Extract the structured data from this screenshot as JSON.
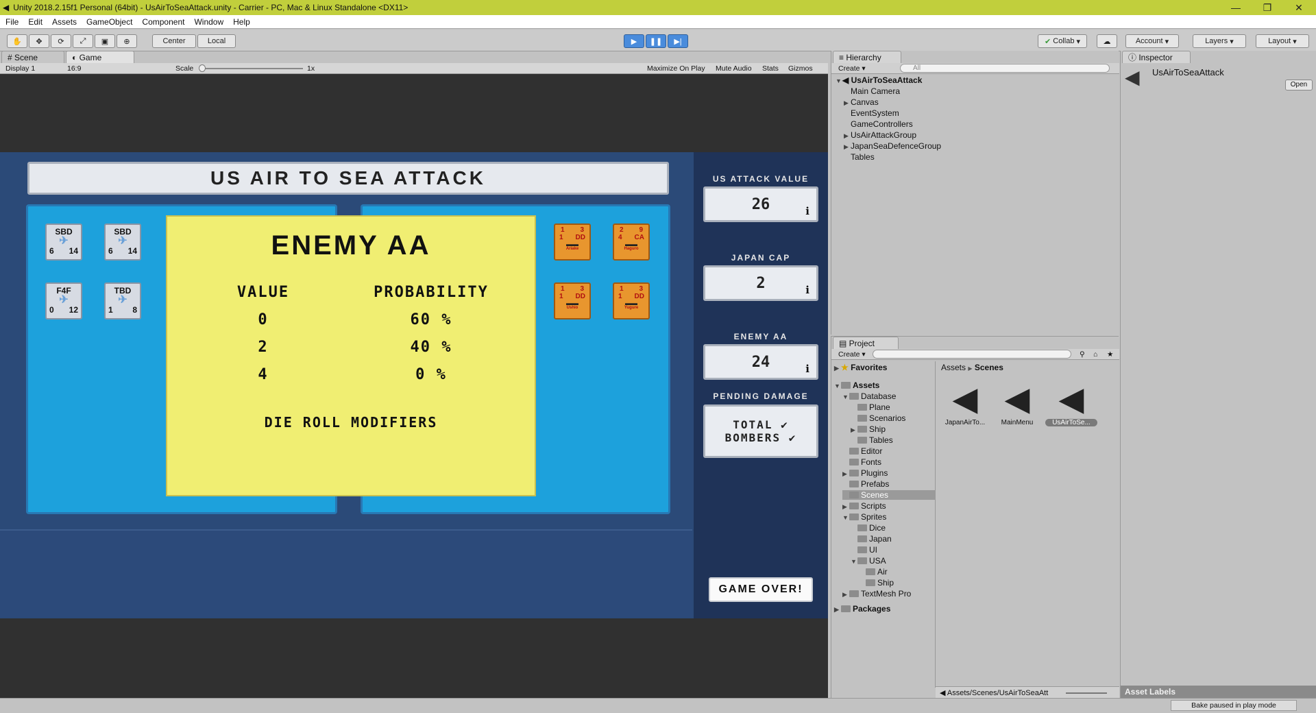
{
  "window": {
    "title": "Unity 2018.2.15f1 Personal (64bit) - UsAirToSeaAttack.unity - Carrier - PC, Mac & Linux Standalone <DX11>",
    "minimize": "—",
    "maximize": "❐",
    "close": "✕"
  },
  "menu": [
    "File",
    "Edit",
    "Assets",
    "GameObject",
    "Component",
    "Window",
    "Help"
  ],
  "toolbar": {
    "center": "Center",
    "local": "Local",
    "collab": "Collab",
    "account": "Account",
    "layers": "Layers",
    "layout": "Layout"
  },
  "scene_tabs": {
    "scene": "Scene",
    "game": "Game",
    "display": "Display 1",
    "aspect": "16:9",
    "scale": "Scale",
    "scale_value": "1x",
    "maximize": "Maximize On Play",
    "mute": "Mute Audio",
    "stats": "Stats",
    "gizmos": "Gizmos"
  },
  "game": {
    "title": "US AIR TO SEA ATTACK",
    "us_counters": [
      {
        "type": "SBD",
        "attack": "6",
        "range": "14"
      },
      {
        "type": "SBD",
        "attack": "6",
        "range": "14"
      },
      {
        "type": "F4F",
        "attack": "0",
        "range": "12"
      },
      {
        "type": "TBD",
        "attack": "1",
        "range": "8"
      }
    ],
    "japan_counters": [
      {
        "a": "1",
        "b": "3",
        "c": "1",
        "cls": "DD",
        "name": "Ariake"
      },
      {
        "a": "2",
        "b": "9",
        "c": "4",
        "cls": "CA",
        "name": "Haguro"
      },
      {
        "a": "1",
        "b": "3",
        "c": "1",
        "cls": "DD",
        "name": "Ushio"
      },
      {
        "a": "1",
        "b": "3",
        "c": "1",
        "cls": "DD",
        "name": "Yugure"
      }
    ],
    "popup": {
      "title": "ENEMY AA",
      "col_value": "VALUE",
      "col_prob": "PROBABILITY",
      "rows": [
        {
          "value": "0",
          "prob": "60 %"
        },
        {
          "value": "2",
          "prob": "40 %"
        },
        {
          "value": "4",
          "prob": "0 %"
        }
      ],
      "modifiers": "DIE ROLL MODIFIERS"
    },
    "side": {
      "us_attack_label": "US ATTACK VALUE",
      "us_attack": "26",
      "japan_cap_label": "JAPAN CAP",
      "japan_cap": "2",
      "enemy_aa_label": "ENEMY AA",
      "enemy_aa": "24",
      "pending_label": "PENDING DAMAGE",
      "pending_1": "TOTAL ✔",
      "pending_2": "BOMBERS ✔",
      "info": "i",
      "game_over": "GAME OVER!"
    }
  },
  "hierarchy": {
    "tab": "Hierarchy",
    "create": "Create",
    "search": "All",
    "root": "UsAirToSeaAttack",
    "items": [
      {
        "label": "Main Camera",
        "arrow": ""
      },
      {
        "label": "Canvas",
        "arrow": "▶"
      },
      {
        "label": "EventSystem",
        "arrow": ""
      },
      {
        "label": "GameControllers",
        "arrow": ""
      },
      {
        "label": "UsAirAttackGroup",
        "arrow": "▶"
      },
      {
        "label": "JapanSeaDefenceGroup",
        "arrow": "▶"
      },
      {
        "label": "Tables",
        "arrow": ""
      }
    ]
  },
  "inspector": {
    "tab": "Inspector",
    "name": "UsAirToSeaAttack",
    "open": "Open",
    "asset_labels": "Asset Labels"
  },
  "project": {
    "tab": "Project",
    "create": "Create",
    "favorites": "Favorites",
    "assets": "Assets",
    "folders": [
      {
        "label": "Database",
        "indent": 1,
        "arrow": "▼"
      },
      {
        "label": "Plane",
        "indent": 2,
        "arrow": ""
      },
      {
        "label": "Scenarios",
        "indent": 2,
        "arrow": ""
      },
      {
        "label": "Ship",
        "indent": 2,
        "arrow": "▶"
      },
      {
        "label": "Tables",
        "indent": 2,
        "arrow": ""
      },
      {
        "label": "Editor",
        "indent": 1,
        "arrow": ""
      },
      {
        "label": "Fonts",
        "indent": 1,
        "arrow": ""
      },
      {
        "label": "Plugins",
        "indent": 1,
        "arrow": "▶"
      },
      {
        "label": "Prefabs",
        "indent": 1,
        "arrow": ""
      },
      {
        "label": "Scenes",
        "indent": 1,
        "arrow": ""
      },
      {
        "label": "Scripts",
        "indent": 1,
        "arrow": "▶"
      },
      {
        "label": "Sprites",
        "indent": 1,
        "arrow": "▼"
      },
      {
        "label": "Dice",
        "indent": 2,
        "arrow": ""
      },
      {
        "label": "Japan",
        "indent": 2,
        "arrow": ""
      },
      {
        "label": "UI",
        "indent": 2,
        "arrow": ""
      },
      {
        "label": "USA",
        "indent": 2,
        "arrow": "▼"
      },
      {
        "label": "Air",
        "indent": 3,
        "arrow": ""
      },
      {
        "label": "Ship",
        "indent": 3,
        "arrow": ""
      },
      {
        "label": "TextMesh Pro",
        "indent": 1,
        "arrow": "▶"
      }
    ],
    "packages": "Packages",
    "breadcrumb_root": "Assets",
    "breadcrumb_sep": "▶",
    "breadcrumb_leaf": "Scenes",
    "scenes": [
      "JapanAirTo...",
      "MainMenu",
      "UsAirToSe..."
    ],
    "path": "Assets/Scenes/UsAirToSeaAtt"
  },
  "status": {
    "bake": "Bake paused in play mode"
  }
}
